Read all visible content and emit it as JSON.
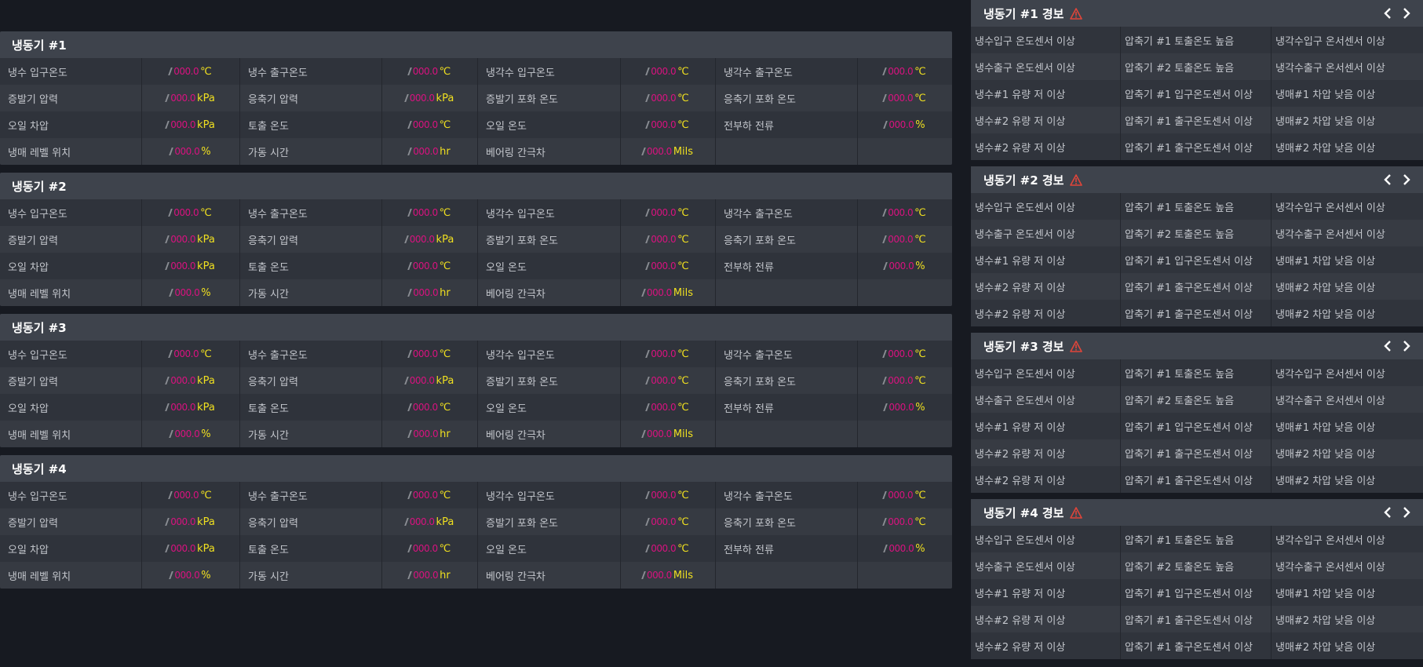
{
  "colors": {
    "value": "#d8127f",
    "unit": "#f0e020",
    "warning": "#e0453a"
  },
  "chillers": [
    {
      "title": "냉동기 #1",
      "rows": [
        [
          {
            "label": "냉수 입구온도",
            "value": "000.0",
            "unit": "℃"
          },
          {
            "label": "냉수 출구온도",
            "value": "000.0",
            "unit": "℃"
          },
          {
            "label": "냉각수 입구온도",
            "value": "000.0",
            "unit": "℃"
          },
          {
            "label": "냉각수 출구온도",
            "value": "000.0",
            "unit": "℃"
          }
        ],
        [
          {
            "label": "증발기 압력",
            "value": "000.0",
            "unit": "kPa"
          },
          {
            "label": "응축기 압력",
            "value": "000.0",
            "unit": "kPa"
          },
          {
            "label": "증발기 포화 온도",
            "value": "000.0",
            "unit": "℃"
          },
          {
            "label": "응축기 포화 온도",
            "value": "000.0",
            "unit": "℃"
          }
        ],
        [
          {
            "label": "오일 차압",
            "value": "000.0",
            "unit": "kPa"
          },
          {
            "label": "토출 온도",
            "value": "000.0",
            "unit": "℃"
          },
          {
            "label": "오일 온도",
            "value": "000.0",
            "unit": "℃"
          },
          {
            "label": "전부하 전류",
            "value": "000.0",
            "unit": "%"
          }
        ],
        [
          {
            "label": "냉매 레벨 위치",
            "value": "000.0",
            "unit": "%"
          },
          {
            "label": "가동 시간",
            "value": "000.0",
            "unit": "hr"
          },
          {
            "label": "베어링 간극차",
            "value": "000.0",
            "unit": "Mils"
          },
          {
            "label": "",
            "value": "",
            "unit": ""
          }
        ]
      ]
    },
    {
      "title": "냉동기 #2",
      "rows": [
        [
          {
            "label": "냉수 입구온도",
            "value": "000.0",
            "unit": "℃"
          },
          {
            "label": "냉수 출구온도",
            "value": "000.0",
            "unit": "℃"
          },
          {
            "label": "냉각수 입구온도",
            "value": "000.0",
            "unit": "℃"
          },
          {
            "label": "냉각수 출구온도",
            "value": "000.0",
            "unit": "℃"
          }
        ],
        [
          {
            "label": "증발기 압력",
            "value": "000.0",
            "unit": "kPa"
          },
          {
            "label": "응축기 압력",
            "value": "000.0",
            "unit": "kPa"
          },
          {
            "label": "증발기 포화 온도",
            "value": "000.0",
            "unit": "℃"
          },
          {
            "label": "응축기 포화 온도",
            "value": "000.0",
            "unit": "℃"
          }
        ],
        [
          {
            "label": "오일 차압",
            "value": "000.0",
            "unit": "kPa"
          },
          {
            "label": "토출 온도",
            "value": "000.0",
            "unit": "℃"
          },
          {
            "label": "오일 온도",
            "value": "000.0",
            "unit": "℃"
          },
          {
            "label": "전부하 전류",
            "value": "000.0",
            "unit": "%"
          }
        ],
        [
          {
            "label": "냉매 레벨 위치",
            "value": "000.0",
            "unit": "%"
          },
          {
            "label": "가동 시간",
            "value": "000.0",
            "unit": "hr"
          },
          {
            "label": "베어링 간극차",
            "value": "000.0",
            "unit": "Mils"
          },
          {
            "label": "",
            "value": "",
            "unit": ""
          }
        ]
      ]
    },
    {
      "title": "냉동기 #3",
      "rows": [
        [
          {
            "label": "냉수 입구온도",
            "value": "000.0",
            "unit": "℃"
          },
          {
            "label": "냉수 출구온도",
            "value": "000.0",
            "unit": "℃"
          },
          {
            "label": "냉각수 입구온도",
            "value": "000.0",
            "unit": "℃"
          },
          {
            "label": "냉각수 출구온도",
            "value": "000.0",
            "unit": "℃"
          }
        ],
        [
          {
            "label": "증발기 압력",
            "value": "000.0",
            "unit": "kPa"
          },
          {
            "label": "응축기 압력",
            "value": "000.0",
            "unit": "kPa"
          },
          {
            "label": "증발기 포화 온도",
            "value": "000.0",
            "unit": "℃"
          },
          {
            "label": "응축기 포화 온도",
            "value": "000.0",
            "unit": "℃"
          }
        ],
        [
          {
            "label": "오일 차압",
            "value": "000.0",
            "unit": "kPa"
          },
          {
            "label": "토출 온도",
            "value": "000.0",
            "unit": "℃"
          },
          {
            "label": "오일 온도",
            "value": "000.0",
            "unit": "℃"
          },
          {
            "label": "전부하 전류",
            "value": "000.0",
            "unit": "%"
          }
        ],
        [
          {
            "label": "냉매 레벨 위치",
            "value": "000.0",
            "unit": "%"
          },
          {
            "label": "가동 시간",
            "value": "000.0",
            "unit": "hr"
          },
          {
            "label": "베어링 간극차",
            "value": "000.0",
            "unit": "Mils"
          },
          {
            "label": "",
            "value": "",
            "unit": ""
          }
        ]
      ]
    },
    {
      "title": "냉동기 #4",
      "rows": [
        [
          {
            "label": "냉수 입구온도",
            "value": "000.0",
            "unit": "℃"
          },
          {
            "label": "냉수 출구온도",
            "value": "000.0",
            "unit": "℃"
          },
          {
            "label": "냉각수 입구온도",
            "value": "000.0",
            "unit": "℃"
          },
          {
            "label": "냉각수 출구온도",
            "value": "000.0",
            "unit": "℃"
          }
        ],
        [
          {
            "label": "증발기 압력",
            "value": "000.0",
            "unit": "kPa"
          },
          {
            "label": "응축기 압력",
            "value": "000.0",
            "unit": "kPa"
          },
          {
            "label": "증발기 포화 온도",
            "value": "000.0",
            "unit": "℃"
          },
          {
            "label": "응축기 포화 온도",
            "value": "000.0",
            "unit": "℃"
          }
        ],
        [
          {
            "label": "오일 차압",
            "value": "000.0",
            "unit": "kPa"
          },
          {
            "label": "토출 온도",
            "value": "000.0",
            "unit": "℃"
          },
          {
            "label": "오일 온도",
            "value": "000.0",
            "unit": "℃"
          },
          {
            "label": "전부하 전류",
            "value": "000.0",
            "unit": "%"
          }
        ],
        [
          {
            "label": "냉매 레벨 위치",
            "value": "000.0",
            "unit": "%"
          },
          {
            "label": "가동 시간",
            "value": "000.0",
            "unit": "hr"
          },
          {
            "label": "베어링 간극차",
            "value": "000.0",
            "unit": "Mils"
          },
          {
            "label": "",
            "value": "",
            "unit": ""
          }
        ]
      ]
    }
  ],
  "alarms": [
    {
      "title": "냉동기 #1 경보",
      "rows": [
        [
          "냉수입구 온도센서 이상",
          "압축기 #1 토출온도 높음",
          "냉각수입구 온서센서 이상"
        ],
        [
          "냉수출구 온도센서 이상",
          "압축기 #2 토출온도 높음",
          "냉각수출구 온서센서 이상"
        ],
        [
          "냉수#1 유량 저 이상",
          "압축기 #1 입구온도센서 이상",
          "냉매#1 차압 낮음 이상"
        ],
        [
          "냉수#2 유량 저 이상",
          "압축기 #1 출구온도센서 이상",
          "냉매#2 차압 낮음 이상"
        ],
        [
          "냉수#2 유량 저 이상",
          "압축기 #1 출구온도센서 이상",
          "냉매#2 차압 낮음 이상"
        ]
      ]
    },
    {
      "title": "냉동기 #2 경보",
      "rows": [
        [
          "냉수입구 온도센서 이상",
          "압축기 #1 토출온도 높음",
          "냉각수입구 온서센서 이상"
        ],
        [
          "냉수출구 온도센서 이상",
          "압축기 #2 토출온도 높음",
          "냉각수출구 온서센서 이상"
        ],
        [
          "냉수#1 유량 저 이상",
          "압축기 #1 입구온도센서 이상",
          "냉매#1 차압 낮음 이상"
        ],
        [
          "냉수#2 유량 저 이상",
          "압축기 #1 출구온도센서 이상",
          "냉매#2 차압 낮음 이상"
        ],
        [
          "냉수#2 유량 저 이상",
          "압축기 #1 출구온도센서 이상",
          "냉매#2 차압 낮음 이상"
        ]
      ]
    },
    {
      "title": "냉동기 #3 경보",
      "rows": [
        [
          "냉수입구 온도센서 이상",
          "압축기 #1 토출온도 높음",
          "냉각수입구 온서센서 이상"
        ],
        [
          "냉수출구 온도센서 이상",
          "압축기 #2 토출온도 높음",
          "냉각수출구 온서센서 이상"
        ],
        [
          "냉수#1 유량 저 이상",
          "압축기 #1 입구온도센서 이상",
          "냉매#1 차압 낮음 이상"
        ],
        [
          "냉수#2 유량 저 이상",
          "압축기 #1 출구온도센서 이상",
          "냉매#2 차압 낮음 이상"
        ],
        [
          "냉수#2 유량 저 이상",
          "압축기 #1 출구온도센서 이상",
          "냉매#2 차압 낮음 이상"
        ]
      ]
    },
    {
      "title": "냉동기 #4 경보",
      "rows": [
        [
          "냉수입구 온도센서 이상",
          "압축기 #1 토출온도 높음",
          "냉각수입구 온서센서 이상"
        ],
        [
          "냉수출구 온도센서 이상",
          "압축기 #2 토출온도 높음",
          "냉각수출구 온서센서 이상"
        ],
        [
          "냉수#1 유량 저 이상",
          "압축기 #1 입구온도센서 이상",
          "냉매#1 차압 낮음 이상"
        ],
        [
          "냉수#2 유량 저 이상",
          "압축기 #1 출구온도센서 이상",
          "냉매#2 차압 낮음 이상"
        ],
        [
          "냉수#2 유량 저 이상",
          "압축기 #1 출구온도센서 이상",
          "냉매#2 차압 낮음 이상"
        ]
      ]
    }
  ]
}
